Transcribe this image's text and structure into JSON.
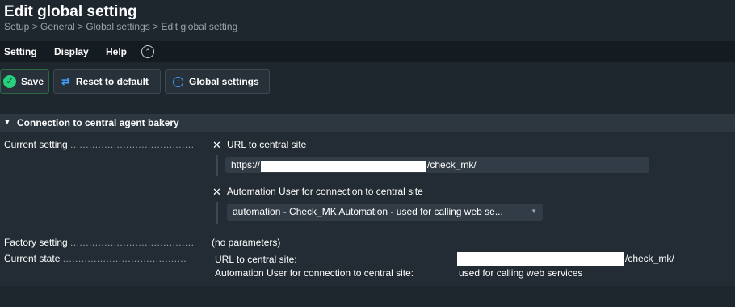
{
  "header": {
    "title": "Edit global setting",
    "breadcrumb": "Setup > General > Global settings > Edit global setting"
  },
  "menu": {
    "items": [
      "Setting",
      "Display",
      "Help"
    ],
    "collapse_icon": "chevron-up-circle-icon"
  },
  "toolbar": {
    "save_label": "Save",
    "reset_label": "Reset to default",
    "global_label": "Global settings"
  },
  "section": {
    "title": "Connection to central agent bakery",
    "current_setting_label": "Current setting",
    "factory_setting_label": "Factory setting",
    "current_state_label": "Current state",
    "dots": "........................................",
    "url_field_label": "URL to central site",
    "url_value_prefix": "https://",
    "url_value_suffix": "/check_mk/",
    "user_field_label": "Automation User for connection to central site",
    "user_select_value": "automation - Check_MK Automation - used for calling web se...",
    "factory_value": "(no parameters)",
    "state_url_label": "URL to central site:",
    "state_url_suffix": "/check_mk/",
    "state_user_label": "Automation User for connection to central site:",
    "state_user_value": "used for calling web services"
  },
  "colors": {
    "background": "#1e262e",
    "accent_green": "#26d07c",
    "accent_blue": "#3da3ff"
  }
}
